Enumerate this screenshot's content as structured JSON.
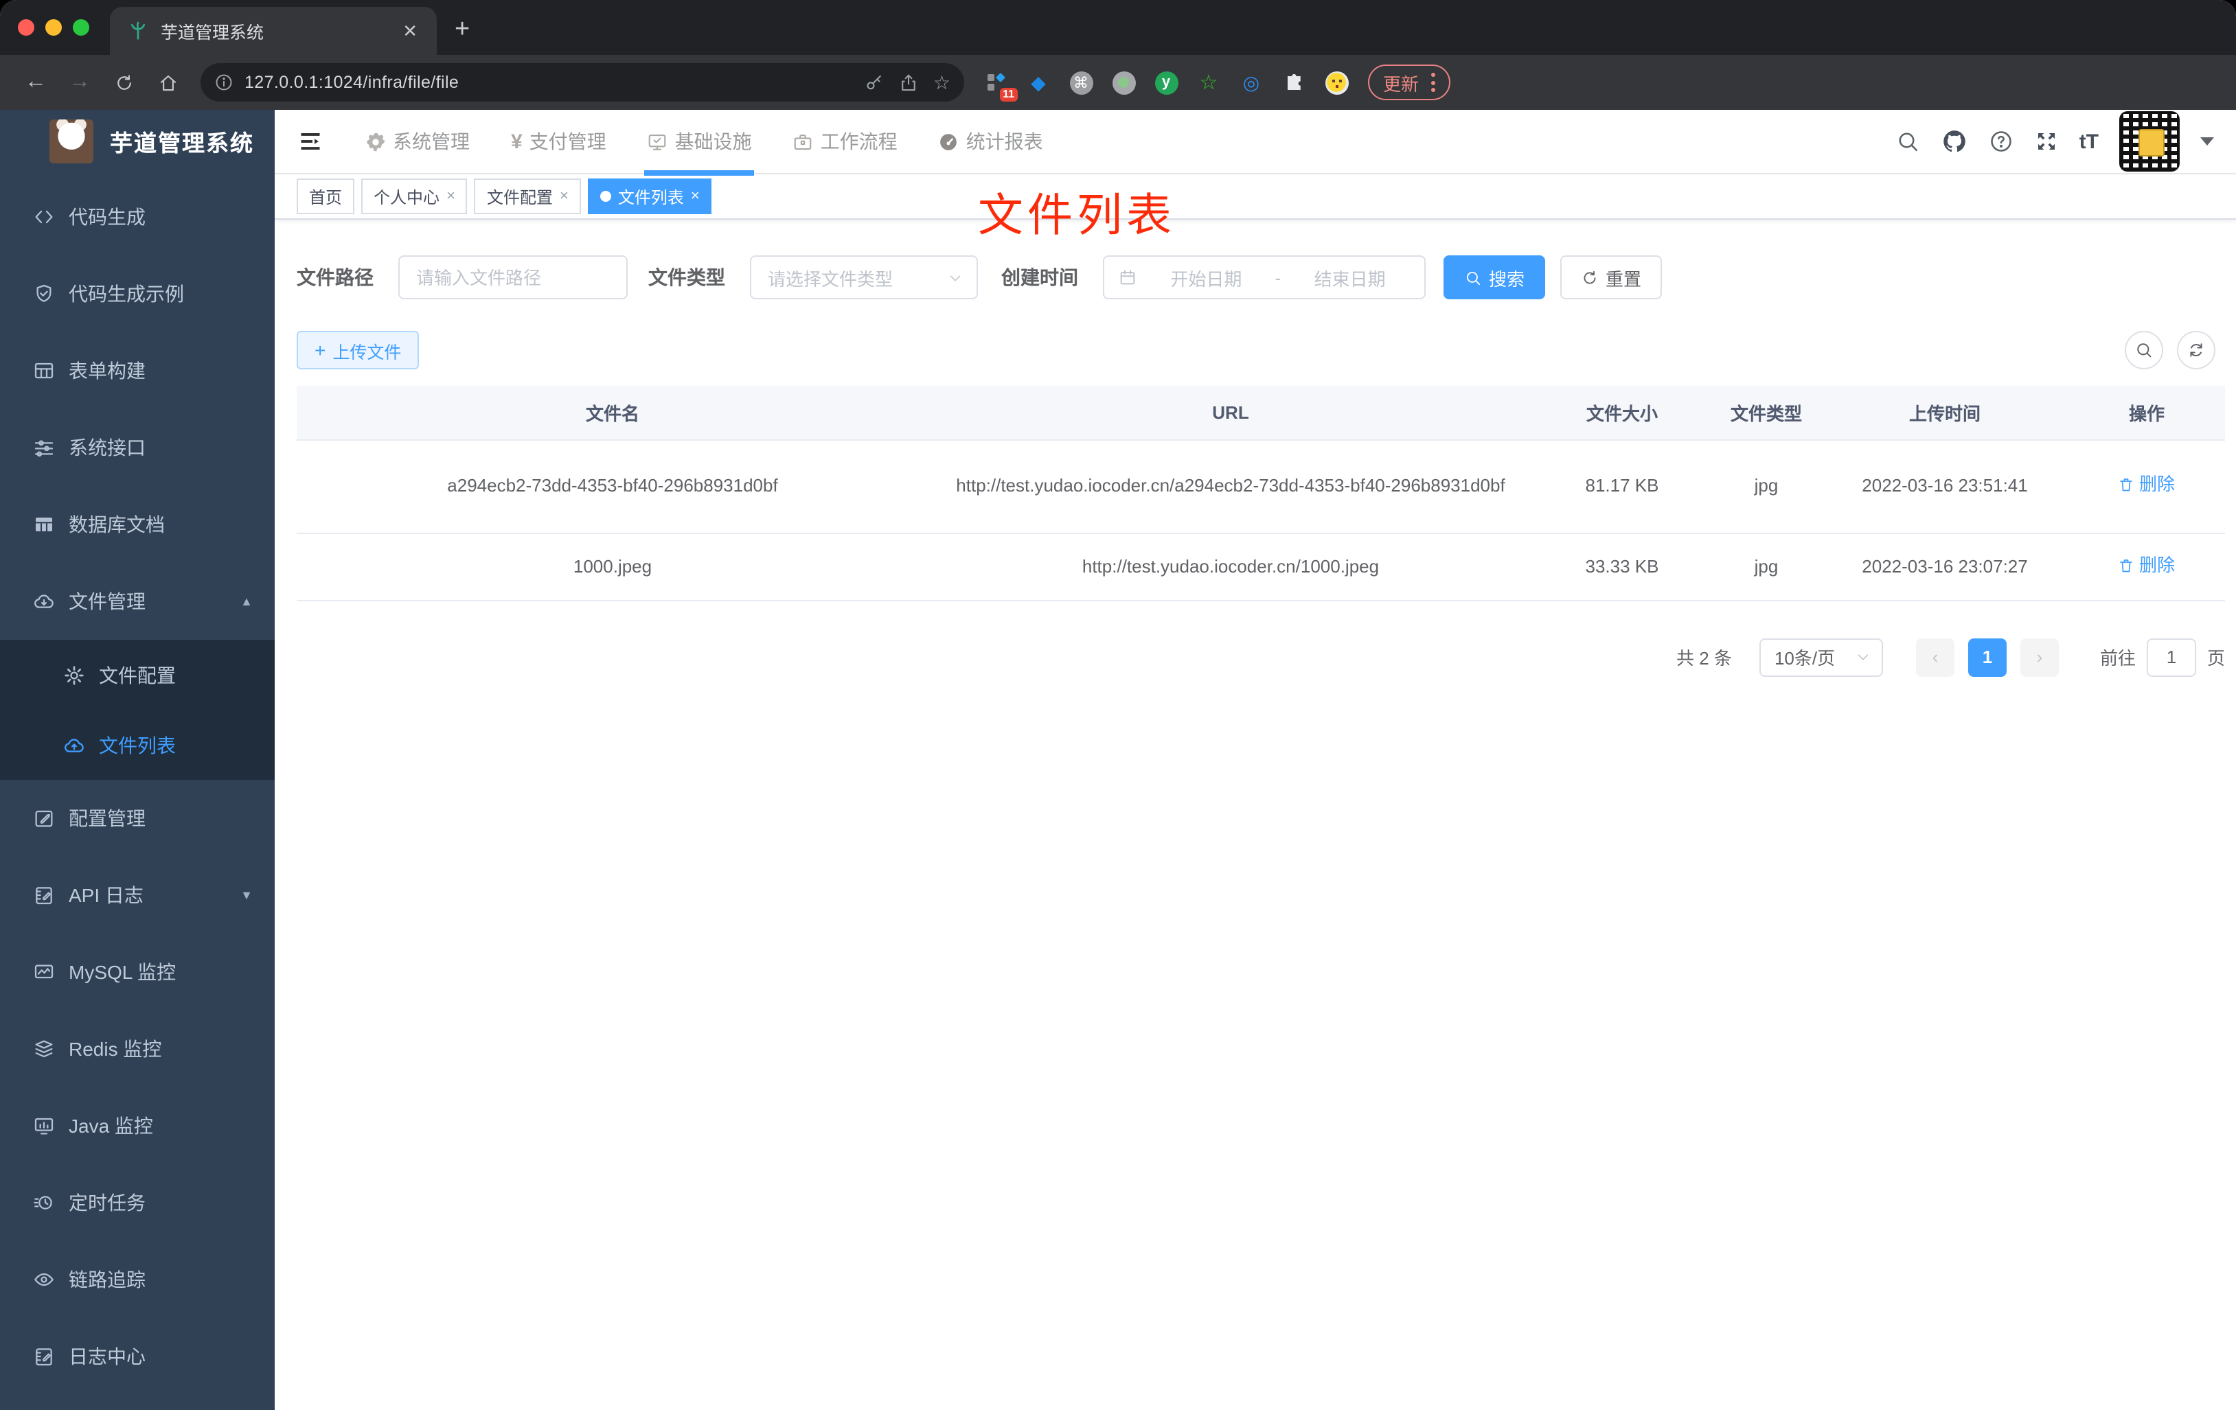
{
  "browser": {
    "tab_title": "芋道管理系统",
    "close_tab": "✕",
    "new_tab": "+",
    "url": "127.0.0.1:1024/infra/file/file",
    "ext_badge": "11",
    "ext_y_letter": "y",
    "update_label": "更新"
  },
  "sidebar": {
    "title": "芋道管理系统",
    "items": [
      {
        "label": "代码生成"
      },
      {
        "label": "代码生成示例"
      },
      {
        "label": "表单构建"
      },
      {
        "label": "系统接口"
      },
      {
        "label": "数据库文档"
      },
      {
        "label": "文件管理"
      },
      {
        "label": "文件配置"
      },
      {
        "label": "文件列表"
      },
      {
        "label": "配置管理"
      },
      {
        "label": "API 日志"
      },
      {
        "label": "MySQL 监控"
      },
      {
        "label": "Redis 监控"
      },
      {
        "label": "Java 监控"
      },
      {
        "label": "定时任务"
      },
      {
        "label": "链路追踪"
      },
      {
        "label": "日志中心"
      }
    ]
  },
  "navbar": {
    "menus": [
      {
        "label": "系统管理"
      },
      {
        "label": "支付管理"
      },
      {
        "label": "基础设施"
      },
      {
        "label": "工作流程"
      },
      {
        "label": "统计报表"
      }
    ],
    "yen": "¥",
    "font_size_glyph": "tT"
  },
  "tags": {
    "items": [
      {
        "label": "首页"
      },
      {
        "label": "个人中心"
      },
      {
        "label": "文件配置"
      },
      {
        "label": "文件列表"
      }
    ],
    "close_glyph": "×"
  },
  "annotation": {
    "text": "文件列表"
  },
  "filters": {
    "path_label": "文件路径",
    "path_placeholder": "请输入文件路径",
    "type_label": "文件类型",
    "type_placeholder": "请选择文件类型",
    "date_label": "创建时间",
    "date_start": "开始日期",
    "date_sep": "-",
    "date_end": "结束日期",
    "search_label": "搜索",
    "reset_label": "重置"
  },
  "toolbar": {
    "upload_label": "上传文件",
    "plus": "+"
  },
  "table": {
    "columns": [
      "文件名",
      "URL",
      "文件大小",
      "文件类型",
      "上传时间",
      "操作"
    ],
    "rows": [
      {
        "name": "a294ecb2-73dd-4353-bf40-296b8931d0bf",
        "url": "http://test.yudao.iocoder.cn/a294ecb2-73dd-4353-bf40-296b8931d0bf",
        "size": "81.17 KB",
        "type": "jpg",
        "time": "2022-03-16 23:51:41",
        "action": "删除"
      },
      {
        "name": "1000.jpeg",
        "url": "http://test.yudao.iocoder.cn/1000.jpeg",
        "size": "33.33 KB",
        "type": "jpg",
        "time": "2022-03-16 23:07:27",
        "action": "删除"
      }
    ]
  },
  "pagination": {
    "total": "共 2 条",
    "page_size": "10条/页",
    "prev": "‹",
    "page": "1",
    "next": "›",
    "goto_label": "前往",
    "goto_value": "1",
    "goto_suffix": "页"
  },
  "colors": {
    "primary": "#409eff",
    "sidebar_bg": "#304156",
    "annotation_red": "#fb2b0a"
  }
}
